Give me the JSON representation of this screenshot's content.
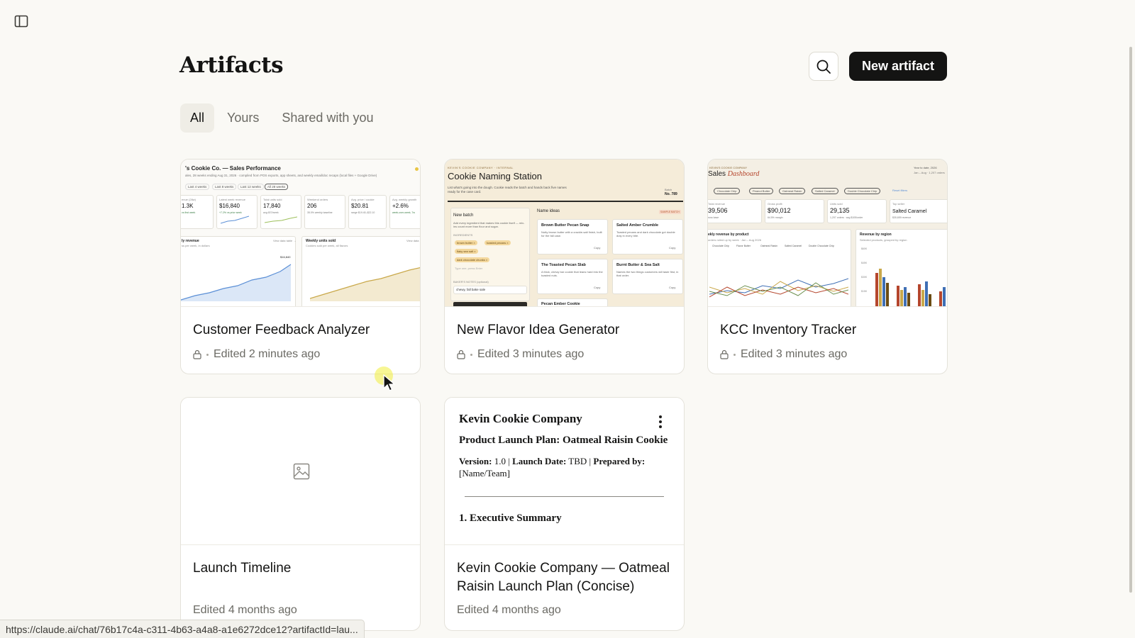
{
  "page": {
    "title": "Artifacts",
    "new_button": "New artifact",
    "tabs": [
      {
        "label": "All",
        "active": true
      },
      {
        "label": "Yours",
        "active": false
      },
      {
        "label": "Shared with you",
        "active": false
      }
    ]
  },
  "cards": [
    {
      "title": "Customer Feedback Analyzer",
      "edited": "Edited 2 minutes ago",
      "private": true,
      "preview": {
        "heading": "'s Cookie Co. — Sales Performance",
        "subheading": "ales, 28 weeks ending Aug 31, 2026 · compiled from POS exports, app sheets, and weekly email/doc recaps (local files + Google Drive)",
        "filters": [
          "Last 4 weeks",
          "Last 8 weeks",
          "Last 12 weeks",
          "All 28 weeks"
        ],
        "stats": [
          {
            "label": "enue (28w)",
            "value": "1.3K",
            "note": "vs first week"
          },
          {
            "label": "Latest week revenue",
            "value": "$16,840",
            "note": "+7.2% vs prior week"
          },
          {
            "label": "Total units sold",
            "value": "17,840",
            "note": "avg 637/week"
          },
          {
            "label": "Weekend orders",
            "value": "206",
            "note": "35.0% weekly baseline"
          },
          {
            "label": "Avg. price / cookie",
            "value": "$20.81",
            "note": "range $19.40–$22.10"
          },
          {
            "label": "Avg. weekly growth",
            "value": "+2.6%",
            "note": "week-over-week, 7w"
          }
        ],
        "left_chart": {
          "title": "ly revenue",
          "sub": "ss per week, in dollars",
          "link": "View data table →",
          "peak": "$16,840"
        },
        "right_chart": {
          "title": "Weekly units sold",
          "sub": "Cookies sold per week, all flavors",
          "link": "View data"
        }
      }
    },
    {
      "title": "New Flavor Idea Generator",
      "edited": "Edited 3 minutes ago",
      "private": true,
      "preview": {
        "eyebrow": "KEVIN'S COOKIE COMPANY · INTERNAL",
        "heading": "Cookie Naming Station",
        "sub": "List what's going into the dough. Cookie reads the batch and hands back five names ready for the case card.",
        "batch_label": "Batch",
        "batch_no": "No. 789",
        "new_batch": "New batch",
        "new_batch_desc": "Add every ingredient that makes this cookie itself — mix-ins count more than flour and sugar.",
        "ingredients_label": "INGREDIENTS",
        "ingredients": [
          "brown butter ×",
          "toasted pecans ×",
          "flaky sea salt ×",
          "dark chocolate chunks ×"
        ],
        "type_hint": "Type one, press Enter",
        "notes_label": "BAKER'S NOTES (optional)",
        "notes_value": "chewy, fall bake sale",
        "name_ideas": "Name ideas",
        "sample_badge": "SAMPLE BATCH",
        "ideas": [
          {
            "name": "Brown Butter Pecan Snap",
            "desc": "Nutty brown butter with a crackle-salt finish, built for the fall case."
          },
          {
            "name": "Salted Amber Crumble",
            "desc": "Toasted pecans and dark chocolate got double duty in every bite."
          },
          {
            "name": "The Toasted Pecan Slab",
            "desc": "A thick, chewy bar cookie that leans hard into the toasted nuts."
          },
          {
            "name": "Burnt Butter & Sea Salt",
            "desc": "Names the two things customers will taste first, in that order."
          },
          {
            "name": "Pecan Ember Cookie",
            "desc": ""
          }
        ],
        "copy_label": "Copy"
      }
    },
    {
      "title": "KCC Inventory Tracker",
      "edited": "Edited 3 minutes ago",
      "private": true,
      "preview": {
        "eyebrow": "KEVIN'S COOKIE COMPANY",
        "heading_plain": "Sales ",
        "heading_accent": "Dashboard",
        "date_range": "Year to date, 2026",
        "date_sub": "Jan – Aug · 1,207 orders",
        "chips": [
          "Chocolate Chip",
          "Peanut Butter",
          "Oatmeal Raisin",
          "Salted Caramel",
          "Double Chocolate Chip"
        ],
        "reset": "Reset filters",
        "stats": [
          {
            "label": "Total revenue",
            "value": "39,506",
            "note": "ross base"
          },
          {
            "label": "Gross profit",
            "value": "$90,012",
            "note": "64.5% margin"
          },
          {
            "label": "Units sold",
            "value": "29,135",
            "note": "1,207 orders · avg $105/order"
          },
          {
            "label": "Top seller",
            "value": "Salted Caramel",
            "note": "$30,659 revenue"
          }
        ],
        "left_chart": {
          "title": "ekly revenue by product",
          "sub": "orders rolled up by week · Jan – Aug 2026"
        },
        "legend": [
          "Chocolate Chip",
          "Flavor Butter",
          "Oatmeal Raisin",
          "Salted Caramel",
          "Double Chocolate Chip"
        ],
        "right_chart": {
          "title": "Revenue by region",
          "sub": "Selected products, grouped by region"
        },
        "y_ticks": [
          "$60K",
          "$45K",
          "$30K",
          "$15K"
        ]
      }
    },
    {
      "title": "Launch Timeline",
      "edited": "Edited 4 months ago",
      "private": false,
      "preview": {
        "type": "image-placeholder"
      }
    },
    {
      "title": "Kevin Cookie Company — Oatmeal Raisin Launch Plan (Concise)",
      "edited": "Edited 4 months ago",
      "private": false,
      "preview": {
        "company": "Kevin Cookie Company",
        "doc_title": "Product Launch Plan: Oatmeal Raisin Cookie",
        "version_label": "Version:",
        "version": "1.0",
        "launch_label": "Launch Date:",
        "launch": "TBD",
        "prepared_label": "Prepared by:",
        "prepared": "[Name/Team]",
        "section": "1. Executive Summary"
      }
    }
  ],
  "status_bar": {
    "url": "https://claude.ai/chat/76b17c4a-c311-4b63-a4a8-a1e6272dce12?artifactId=lau..."
  },
  "colors": {
    "background": "#faf9f5",
    "primary_button": "#141413",
    "card_border": "#e4e2da",
    "chart_blue": "#5b8fd6",
    "chart_gold": "#c9a84a"
  }
}
